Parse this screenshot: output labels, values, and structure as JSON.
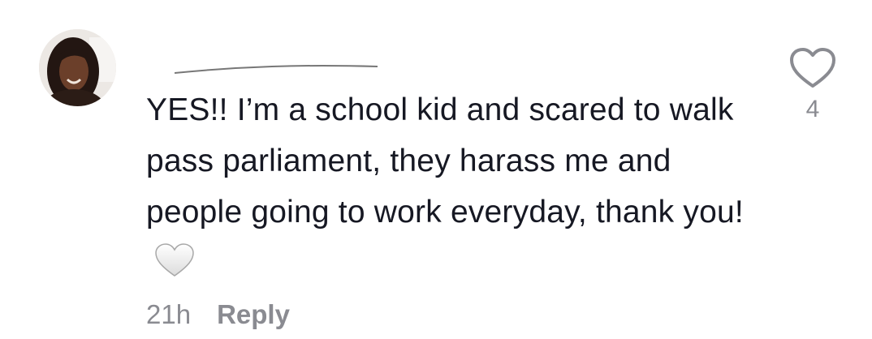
{
  "comment": {
    "avatar_icon": "profile-photo",
    "text": "YES!! I’m a school kid and scared to walk pass parliament, they harass me and people going to work everyday, thank you!",
    "emoji_icon": "white-heart-emoji",
    "timestamp": "21h",
    "reply_label": "Reply",
    "like_icon": "heart-outline-icon",
    "like_count": "4"
  },
  "colors": {
    "text": "#161823",
    "muted": "#8a8b91",
    "background": "#ffffff"
  }
}
